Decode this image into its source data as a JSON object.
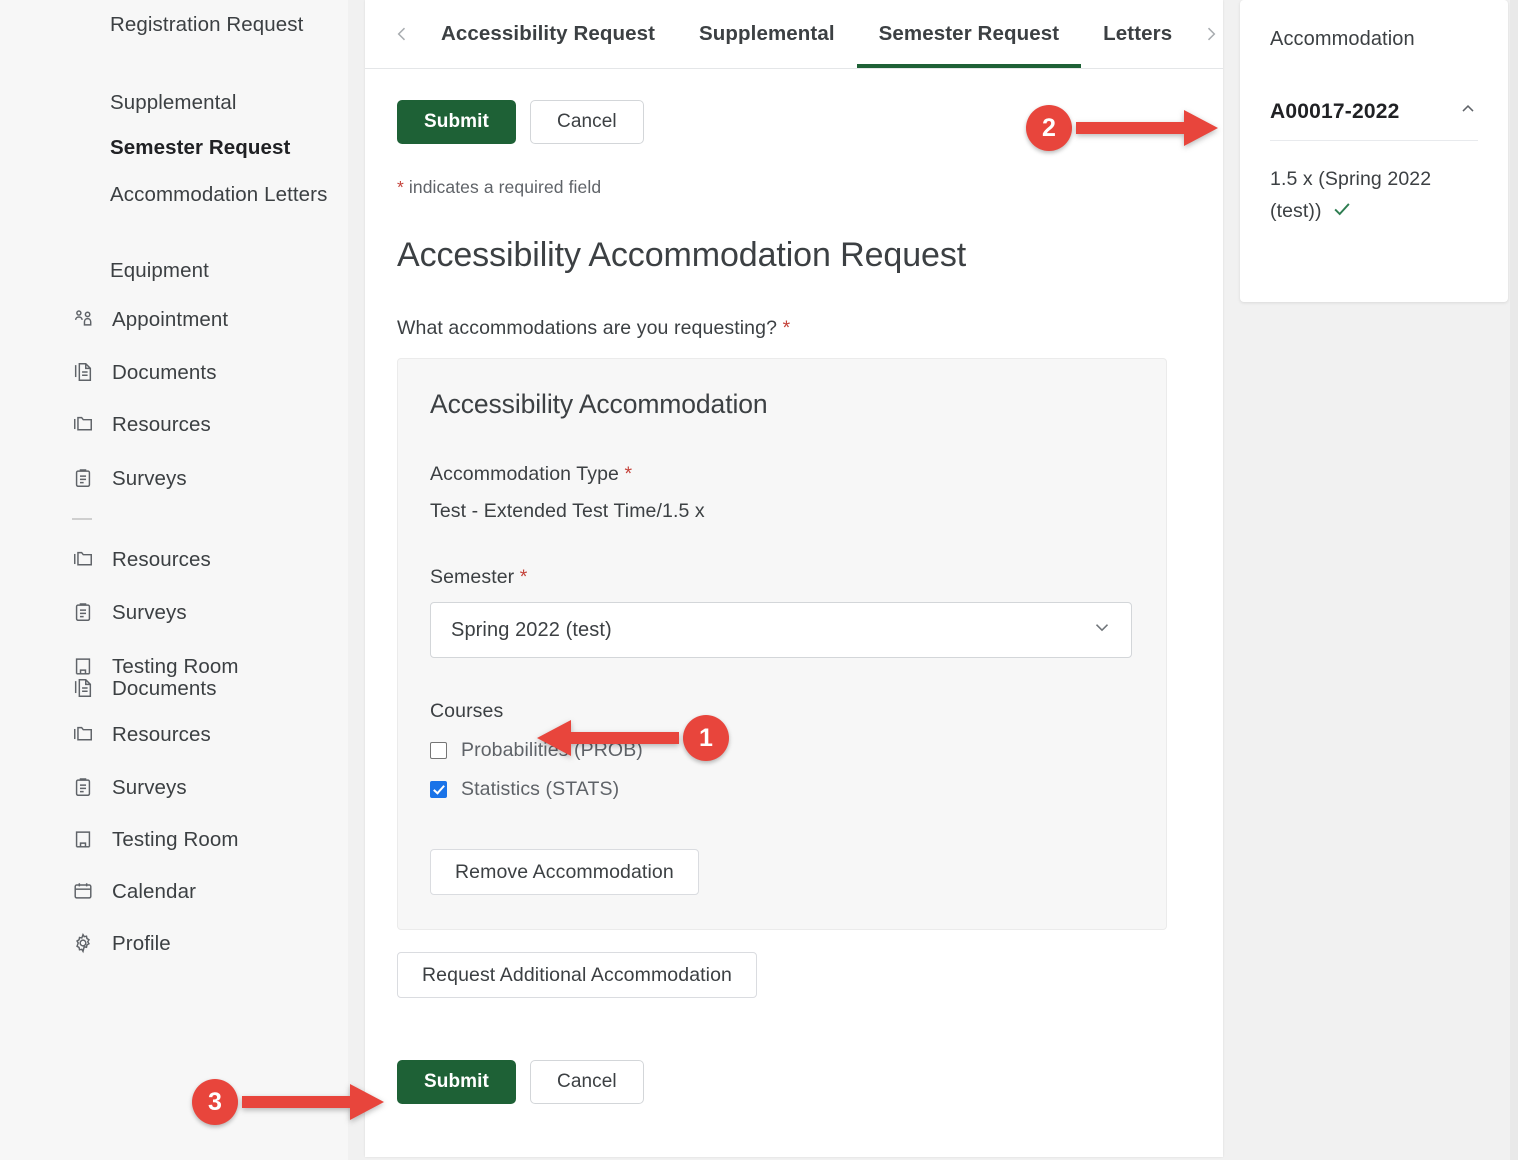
{
  "sidebar": {
    "sub_items": [
      {
        "label": "Registration\nRequest",
        "active": false
      },
      {
        "label": "Supplemental",
        "active": false
      },
      {
        "label": "Semester Request",
        "active": true
      },
      {
        "label": "Accommodation\nLetters",
        "active": false
      },
      {
        "label": "Equipment",
        "active": false
      }
    ],
    "nav_items": [
      {
        "label": "Appointment",
        "icon": "appointment-icon"
      },
      {
        "label": "Documents",
        "icon": "documents-icon"
      },
      {
        "label": "Resources",
        "icon": "resources-folder-icon"
      },
      {
        "label": "Surveys",
        "icon": "surveys-clipboard-icon"
      },
      {
        "label": "Resources",
        "icon": "resources-folder-icon"
      },
      {
        "label": "Surveys",
        "icon": "surveys-clipboard-icon"
      },
      {
        "label": "Testing Room",
        "icon": "testing-room-icon"
      },
      {
        "label": "Documents",
        "icon": "documents-icon"
      },
      {
        "label": "Resources",
        "icon": "resources-folder-icon"
      },
      {
        "label": "Surveys",
        "icon": "surveys-clipboard-icon"
      },
      {
        "label": "Testing Room",
        "icon": "testing-room-icon"
      },
      {
        "label": "Calendar",
        "icon": "calendar-icon"
      },
      {
        "label": "Profile",
        "icon": "gear-icon"
      }
    ]
  },
  "tabbar": {
    "prev_icon": "chevron-left-icon",
    "next_icon": "chevron-right-icon",
    "tabs": [
      {
        "label": "Accessibility Request",
        "selected": false
      },
      {
        "label": "Supplemental",
        "selected": false
      },
      {
        "label": "Semester Request",
        "selected": true
      },
      {
        "label": "Letters",
        "selected": false
      }
    ]
  },
  "form": {
    "submit_label": "Submit",
    "cancel_label": "Cancel",
    "required_note_star": "*",
    "required_note_text": " indicates a required field",
    "page_title": "Accessibility Accommodation Request",
    "question": "What accommodations are you requesting?",
    "question_star": "*",
    "card": {
      "title": "Accessibility Accommodation",
      "accommodation_type_label": "Accommodation Type",
      "accommodation_type_star": "*",
      "accommodation_type_value": "Test - Extended Test Time/1.5 x",
      "semester_label": "Semester",
      "semester_star": "*",
      "semester_value": "Spring 2022 (test)",
      "semester_caret": "chevron-down-icon",
      "courses_label": "Courses",
      "courses": [
        {
          "label": "Probabilities (PROB)",
          "checked": false
        },
        {
          "label": "Statistics (STATS)",
          "checked": true
        }
      ],
      "remove_label": "Remove Accommodation"
    },
    "request_additional_label": "Request Additional Accommodation",
    "bottom_submit_label": "Submit",
    "bottom_cancel_label": "Cancel"
  },
  "right_panel": {
    "title": "Accommodation",
    "id": "A00017-2022",
    "collapse_icon": "chevron-up-icon",
    "items": [
      {
        "label": "1.5 x (Spring 2022 (test))",
        "status_icon": "check-icon"
      }
    ]
  },
  "annotations": [
    {
      "number": "1"
    },
    {
      "number": "2"
    },
    {
      "number": "3"
    }
  ],
  "colors": {
    "accent_green": "#1e6136",
    "annotation_red": "#e8453c",
    "required_star": "#c5443c",
    "checkbox_blue": "#1a73e8",
    "check_green": "#2e7d51"
  }
}
